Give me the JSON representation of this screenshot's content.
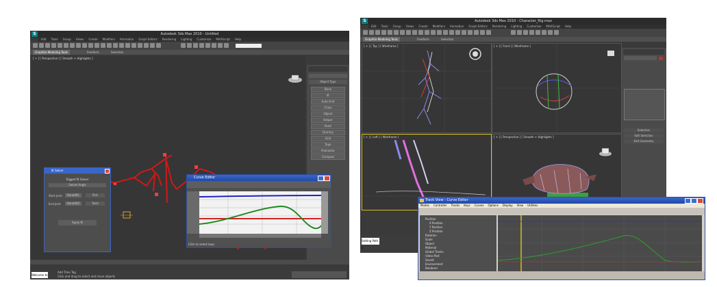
{
  "left_app": {
    "title": "Autodesk 3ds Max 2010  -  Untitled",
    "logo": "S",
    "menu": [
      "Edit",
      "Tools",
      "Group",
      "Views",
      "Create",
      "Modifiers",
      "Animation",
      "Graph Editors",
      "Rendering",
      "Lighting",
      "Customize",
      "MAXScript",
      "Help"
    ],
    "ribbon_tabs": [
      "Graphite Modeling Tools",
      "Freeform",
      "Selection"
    ],
    "viewport_label": "[ + ] [ Perspective ] [ Smooth + Highlights ]",
    "cmd_panel_label": "Object Type",
    "cmd_buttons": [
      "Bone",
      "IK",
      "Auto Grid",
      "Chain",
      "Object",
      "Helper",
      "Point",
      "Dummy",
      "Grid",
      "Tape",
      "Protractor",
      "Compass"
    ],
    "status_text": "Click and drag to select and move objects",
    "status_prompt": "Add Time Tag",
    "welcome": "Welcome to M",
    "ik_dialog": {
      "title": "IK Solver",
      "header": "Rigged IK Solver",
      "row1": "Swivel Angle",
      "field1_label": "Start Joint",
      "field1_value": "Bone001",
      "field2_label": "End Joint",
      "field2_value": "Bone004",
      "btn1": "Pick",
      "btn2": "Twist",
      "footer": "Apply IK"
    },
    "curve_dialog": {
      "title": "Curve Editor",
      "status": "Click to select keys"
    }
  },
  "right_app": {
    "title": "Autodesk 3ds Max 2010  -  Character_Rig.max",
    "logo": "S",
    "menu": [
      "Edit",
      "Tools",
      "Group",
      "Views",
      "Create",
      "Modifiers",
      "Animation",
      "Graph Editors",
      "Rendering",
      "Lighting",
      "Customize",
      "MAXScript",
      "Help"
    ],
    "ribbon_tabs": [
      "Graphite Modeling Tools",
      "Freeform",
      "Selection"
    ],
    "viewports": [
      "[ + ] [ Top ] [ Wireframe ]",
      "[ + ] [ Front ] [ Wireframe ]",
      "[ + ] [ Left ] [ Wireframe ]",
      "[ + ] [ Perspective ] [ Smooth + Highlights ]"
    ],
    "cmd_labels": [
      "Selection",
      "Soft Selection",
      "Edit Geometry"
    ],
    "welcome": "Setting Path C",
    "track_view": {
      "title": "Track View - Curve Editor",
      "menu": [
        "Modes",
        "Controller",
        "Tracks",
        "Keys",
        "Curves",
        "Options",
        "Display",
        "View",
        "Utilities"
      ],
      "tree": [
        "Position",
        "X Position",
        "Y Position",
        "Z Position",
        "Rotation",
        "Scale",
        "Object",
        "Material",
        "Global Tracks",
        "Video Post",
        "Sound",
        "Environment",
        "Renderer"
      ]
    }
  },
  "colors": {
    "max_bg": "#3a3a3a",
    "viewport": "#363636",
    "curve_green": "#1f8a1f",
    "curve_red": "#d02020",
    "curve_blue": "#2020c0",
    "selection_yellow": "#d8c020",
    "window_title": "#2049a8"
  }
}
